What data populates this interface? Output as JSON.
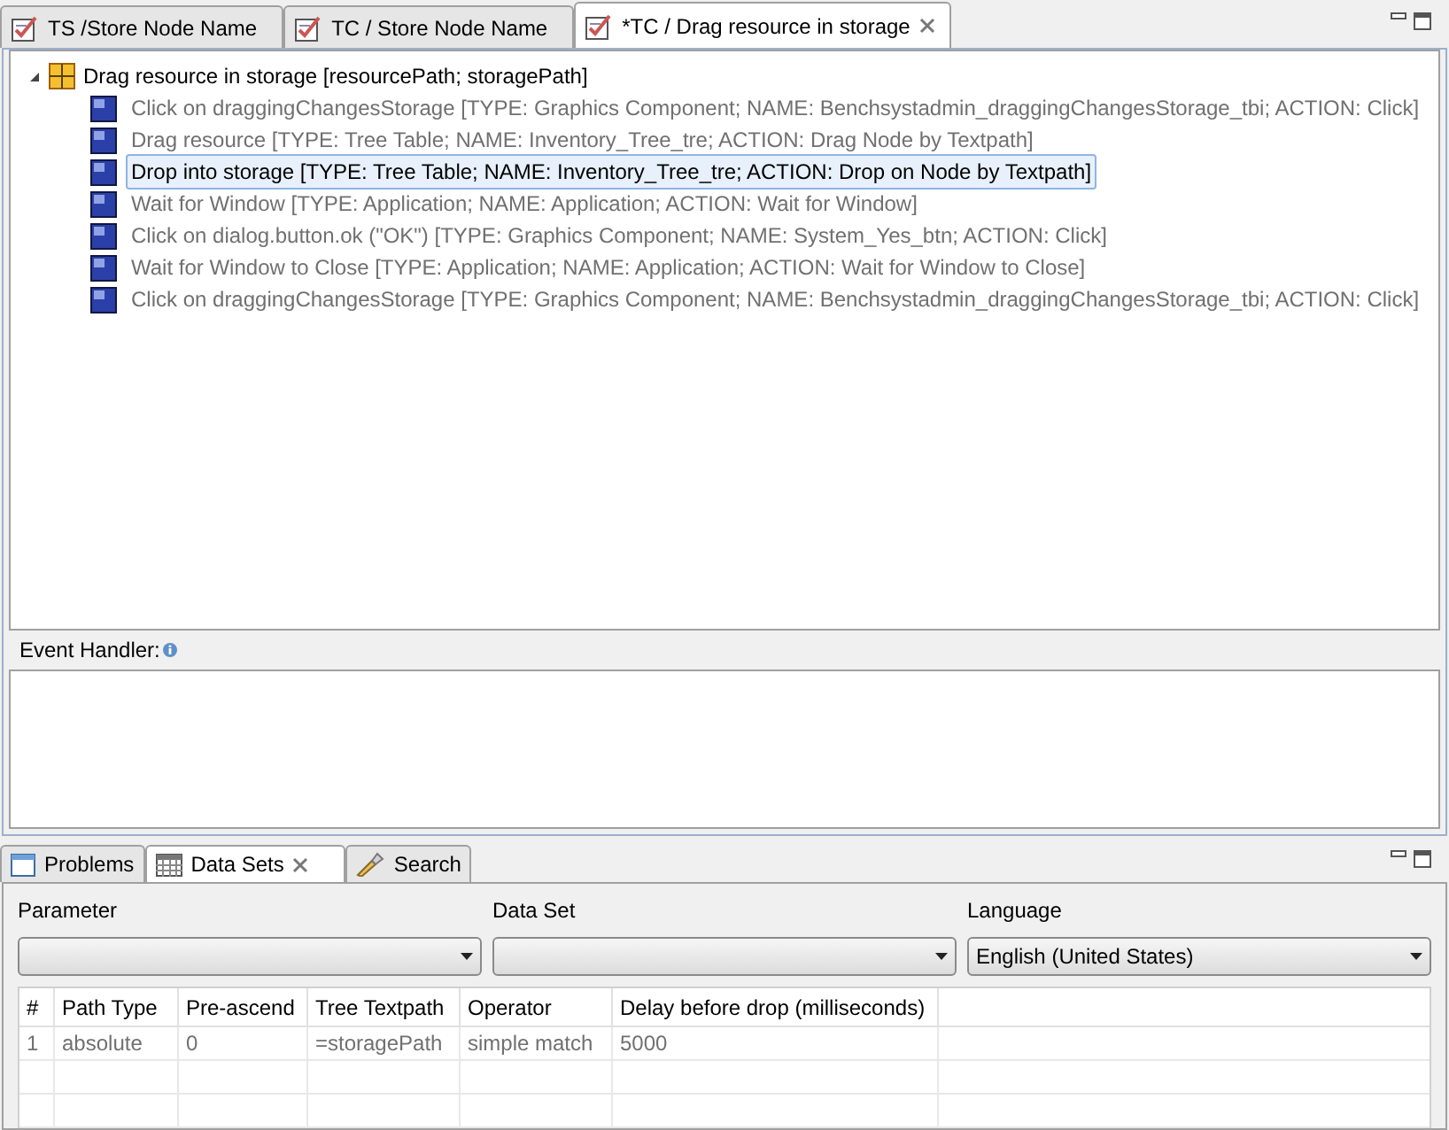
{
  "editor_tabs": [
    {
      "label": "TS /Store Node Name",
      "selected": false,
      "closable": false
    },
    {
      "label": "TC / Store Node Name",
      "selected": false,
      "closable": false
    },
    {
      "label": "*TC / Drag resource in storage",
      "selected": true,
      "closable": true
    }
  ],
  "tree": {
    "label": "Drag resource in storage [resourcePath; storagePath]",
    "expanded": true,
    "children": [
      {
        "label": "Click on draggingChangesStorage [TYPE: Graphics Component; NAME: Benchsystadmin_draggingChangesStorage_tbi; ACTION: Click]",
        "selected": false
      },
      {
        "label": "Drag resource [TYPE: Tree Table; NAME: Inventory_Tree_tre; ACTION: Drag Node by Textpath]",
        "selected": false
      },
      {
        "label": "Drop into storage [TYPE: Tree Table; NAME: Inventory_Tree_tre; ACTION: Drop on Node by Textpath]",
        "selected": true
      },
      {
        "label": "Wait for Window [TYPE: Application; NAME: Application; ACTION: Wait for Window]",
        "selected": false
      },
      {
        "label": "Click on dialog.button.ok (\"OK\") [TYPE: Graphics Component; NAME: System_Yes_btn; ACTION: Click]",
        "selected": false
      },
      {
        "label": "Wait for Window to Close [TYPE: Application; NAME: Application; ACTION: Wait for Window to Close]",
        "selected": false
      },
      {
        "label": "Click on draggingChangesStorage [TYPE: Graphics Component; NAME: Benchsystadmin_draggingChangesStorage_tbi; ACTION: Click]",
        "selected": false
      }
    ]
  },
  "event_handler": {
    "label": "Event Handler:"
  },
  "bottom_tabs": [
    {
      "label": "Problems",
      "kind": "problems",
      "selected": false,
      "closable": false
    },
    {
      "label": "Data Sets",
      "kind": "datasets",
      "selected": true,
      "closable": true
    },
    {
      "label": "Search",
      "kind": "search",
      "selected": false,
      "closable": false
    }
  ],
  "data_sets": {
    "selectors": [
      {
        "label": "Parameter"
      },
      {
        "label": "Data Set"
      },
      {
        "label": "Language",
        "value": "English (United States)"
      }
    ],
    "table": {
      "columns": [
        "#",
        "Path Type",
        "Pre-ascend",
        "Tree Textpath",
        "Operator",
        "Delay before drop (milliseconds)"
      ],
      "rows": [
        [
          "1",
          "absolute",
          "0",
          "=storagePath",
          "simple match",
          "5000"
        ]
      ]
    }
  }
}
